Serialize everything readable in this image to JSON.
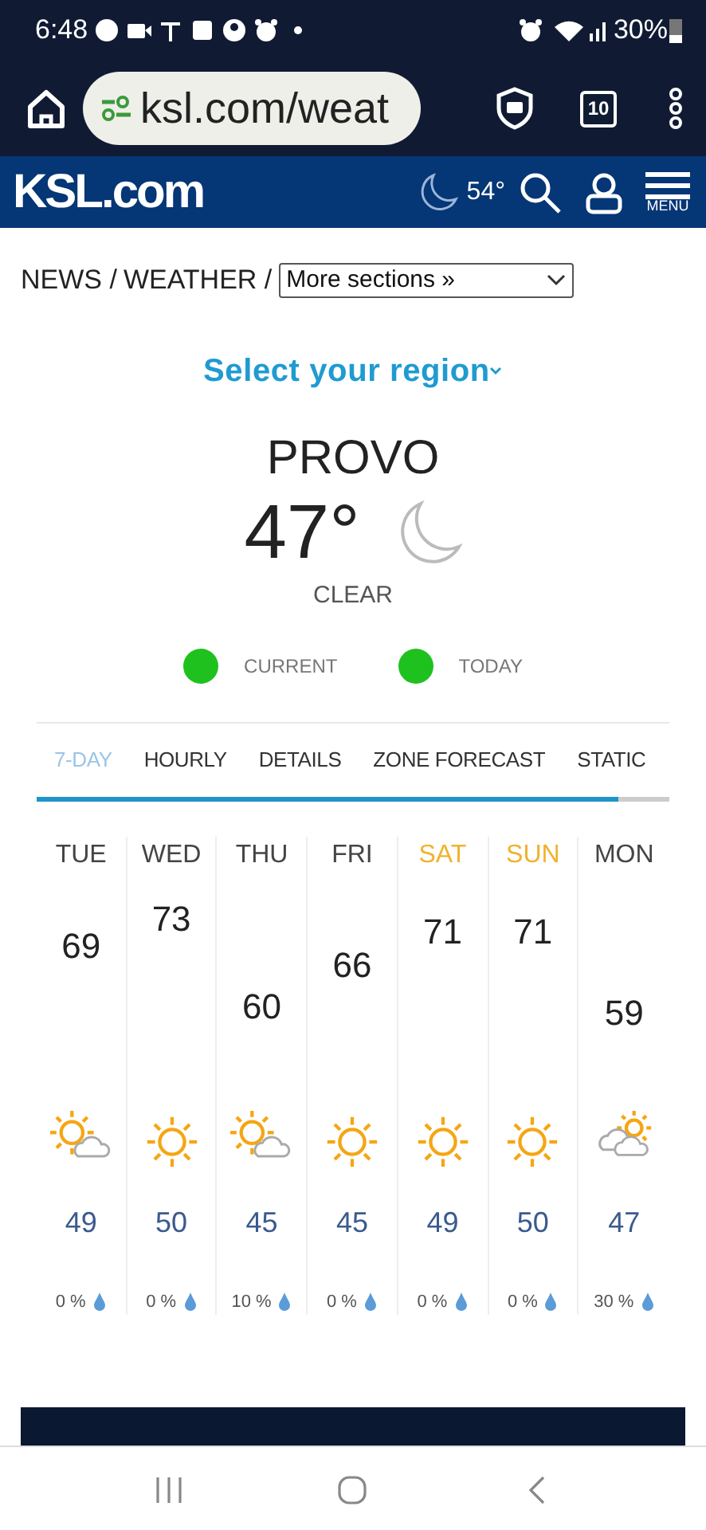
{
  "status_bar": {
    "time": "6:48",
    "battery": "30%"
  },
  "browser": {
    "url": "ksl.com/weat",
    "tab_count": "10"
  },
  "site_header": {
    "logo": "KSL.com",
    "temperature": "54°",
    "menu_label": "MENU"
  },
  "breadcrumb": {
    "items": [
      "NEWS /",
      "WEATHER /"
    ],
    "dropdown": "More sections »"
  },
  "region_selector": "Select your region",
  "current": {
    "city": "PROVO",
    "temperature": "47°",
    "condition": "CLEAR"
  },
  "legend": [
    {
      "label": "CURRENT",
      "color": "#1fc11f"
    },
    {
      "label": "TODAY",
      "color": "#1fc11f"
    }
  ],
  "tabs": [
    {
      "label": "7-DAY",
      "selected": true
    },
    {
      "label": "HOURLY",
      "selected": false
    },
    {
      "label": "DETAILS",
      "selected": false
    },
    {
      "label": "ZONE FORECAST",
      "selected": false
    },
    {
      "label": "STATIC",
      "selected": false
    }
  ],
  "days": [
    {
      "day": "TUE",
      "weekend": false,
      "high": "69",
      "kind": "partly_sunny",
      "low": "49",
      "precip": "0 %"
    },
    {
      "day": "WED",
      "weekend": false,
      "high": "73",
      "kind": "sunny",
      "low": "50",
      "precip": "0 %"
    },
    {
      "day": "THU",
      "weekend": false,
      "high": "60",
      "kind": "partly_sunny",
      "low": "45",
      "precip": "10 %"
    },
    {
      "day": "FRI",
      "weekend": false,
      "high": "66",
      "kind": "sunny",
      "low": "45",
      "precip": "0 %"
    },
    {
      "day": "SAT",
      "weekend": true,
      "high": "71",
      "kind": "sunny",
      "low": "49",
      "precip": "0 %"
    },
    {
      "day": "SUN",
      "weekend": true,
      "high": "71",
      "kind": "sunny",
      "low": "50",
      "precip": "0 %"
    },
    {
      "day": "MON",
      "weekend": false,
      "high": "59",
      "kind": "mostly_cloudy",
      "low": "47",
      "precip": "30 %"
    }
  ]
}
